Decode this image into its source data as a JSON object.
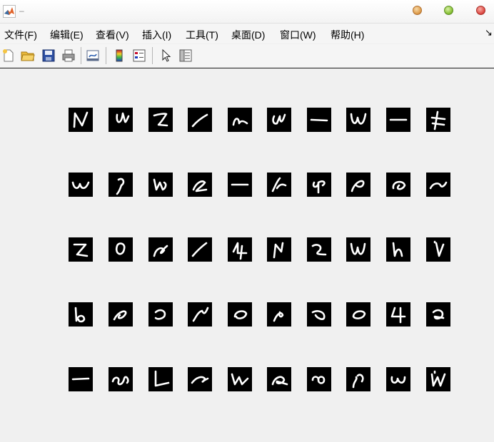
{
  "window": {
    "title": "–",
    "controls": [
      "minimize-button",
      "maximize-button",
      "close-button"
    ]
  },
  "menubar": {
    "items": [
      {
        "id": "file",
        "label": "文件(F)"
      },
      {
        "id": "edit",
        "label": "编辑(E)"
      },
      {
        "id": "view",
        "label": "查看(V)"
      },
      {
        "id": "insert",
        "label": "插入(I)"
      },
      {
        "id": "tools",
        "label": "工具(T)"
      },
      {
        "id": "desktop",
        "label": "桌面(D)"
      },
      {
        "id": "window",
        "label": "窗口(W)"
      },
      {
        "id": "help",
        "label": "帮助(H)"
      }
    ],
    "overflow_icon": "dock-arrow-icon"
  },
  "toolbar": {
    "buttons": [
      "new-figure-icon",
      "open-file-icon",
      "save-icon",
      "print-icon",
      "link-plot-icon",
      "insert-colorbar-icon",
      "insert-legend-icon",
      "select-pointer-icon",
      "property-inspector-icon"
    ]
  },
  "figure": {
    "description_grid": "5 rows x 10 columns of handwritten digit thumbnails",
    "rows": 5,
    "cols": 10,
    "colors": {
      "tile": "#000000",
      "stroke": "#ffffff",
      "background": "#f0f0f0"
    }
  }
}
